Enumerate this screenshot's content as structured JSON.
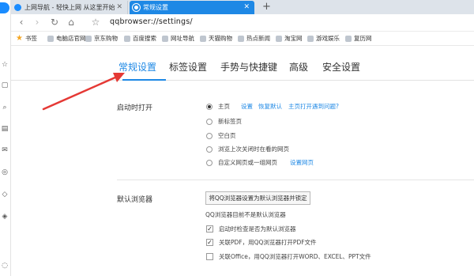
{
  "tabs": [
    {
      "title": "上网导航 - 轻快上网 从这里开始"
    },
    {
      "title": "常规设置"
    }
  ],
  "new_tab_symbol": "+",
  "toolbar": {
    "address": "qqbrowser://settings/"
  },
  "bookmarks": {
    "label": "书签",
    "items": [
      "电脑店官网",
      "京东购物",
      "百度搜索",
      "网址导航",
      "天猫购物",
      "热点新闻",
      "淘宝网",
      "游戏娱乐",
      "复历网"
    ]
  },
  "settings_tabs": [
    "常规设置",
    "标签设置",
    "手势与快捷键",
    "高级",
    "安全设置"
  ],
  "startup": {
    "label": "启动时打开",
    "options": [
      {
        "text": "主页",
        "selected": true
      },
      {
        "text": "新标签页",
        "selected": false
      },
      {
        "text": "空白页",
        "selected": false
      },
      {
        "text": "浏览上次关闭时在看的网页",
        "selected": false
      },
      {
        "text": "自定义网页或一组网页",
        "selected": false
      }
    ],
    "homepage_links": [
      "设置",
      "恢复默认",
      "主页打开遇到问题?"
    ],
    "custom_link": "设置网页"
  },
  "default_browser": {
    "label": "默认浏览器",
    "button": "将QQ浏览器设置为默认浏览器并锁定",
    "status": "QQ浏览器目前不是默认浏览器",
    "checks": [
      {
        "text": "启动时检查是否为默认浏览器",
        "checked": true
      },
      {
        "text": "关联PDF，用QQ浏览器打开PDF文件",
        "checked": true
      },
      {
        "text": "关联Office，用QQ浏览器打开WORD、EXCEL、PPT文件",
        "checked": false
      }
    ]
  },
  "colors": {
    "accent": "#1e88e5",
    "arrow": "#e53935"
  }
}
